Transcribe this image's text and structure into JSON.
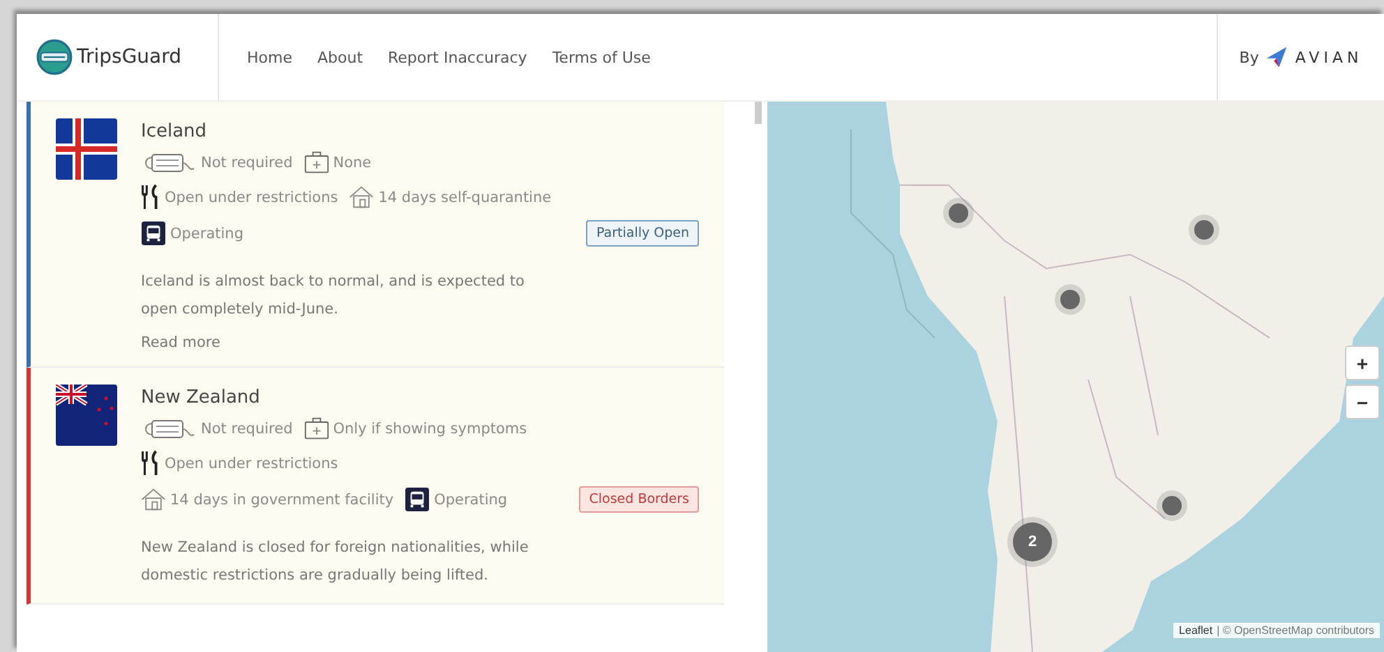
{
  "header": {
    "brand": "TripsGuard",
    "nav": [
      {
        "label": "Home"
      },
      {
        "label": "About"
      },
      {
        "label": "Report Inaccuracy"
      },
      {
        "label": "Terms of Use"
      }
    ],
    "by": "By",
    "partner": "AVIAN"
  },
  "countries": [
    {
      "name": "Iceland",
      "flag": {
        "kind": "iceland"
      },
      "rows": [
        [
          {
            "kind": "mask",
            "text": "Not required"
          },
          {
            "kind": "test",
            "text": "None"
          }
        ],
        [
          {
            "kind": "restaurant",
            "text": "Open under restrictions"
          },
          {
            "kind": "quarantine",
            "text": "14 days self-quarantine"
          }
        ],
        [
          {
            "kind": "transport",
            "text": "Operating"
          }
        ]
      ],
      "status": {
        "kind": "partial",
        "label": "Partially Open"
      },
      "description": "Iceland is almost back to normal, and is expected to open completely mid-June.",
      "read_more": "Read more"
    },
    {
      "name": "New Zealand",
      "flag": {
        "kind": "new-zealand"
      },
      "rows": [
        [
          {
            "kind": "mask",
            "text": "Not required"
          },
          {
            "kind": "test",
            "text": "Only if showing symptoms"
          }
        ],
        [
          {
            "kind": "restaurant",
            "text": "Open under restrictions"
          }
        ],
        [
          {
            "kind": "quarantine",
            "text": "14 days in government facility"
          },
          {
            "kind": "transport",
            "text": "Operating"
          }
        ]
      ],
      "status": {
        "kind": "closed",
        "label": "Closed Borders"
      },
      "description": "New Zealand is closed for foreign nationalities, while domestic restrictions are gradually being lifted."
    }
  ],
  "map": {
    "markers": [
      {
        "kind": "single"
      },
      {
        "kind": "single"
      },
      {
        "kind": "single"
      },
      {
        "kind": "single"
      },
      {
        "kind": "cluster",
        "label": "2"
      }
    ],
    "zoom_in": "+",
    "zoom_out": "−",
    "attribution_link": "Leaflet",
    "attribution": "| © OpenStreetMap contributors"
  }
}
